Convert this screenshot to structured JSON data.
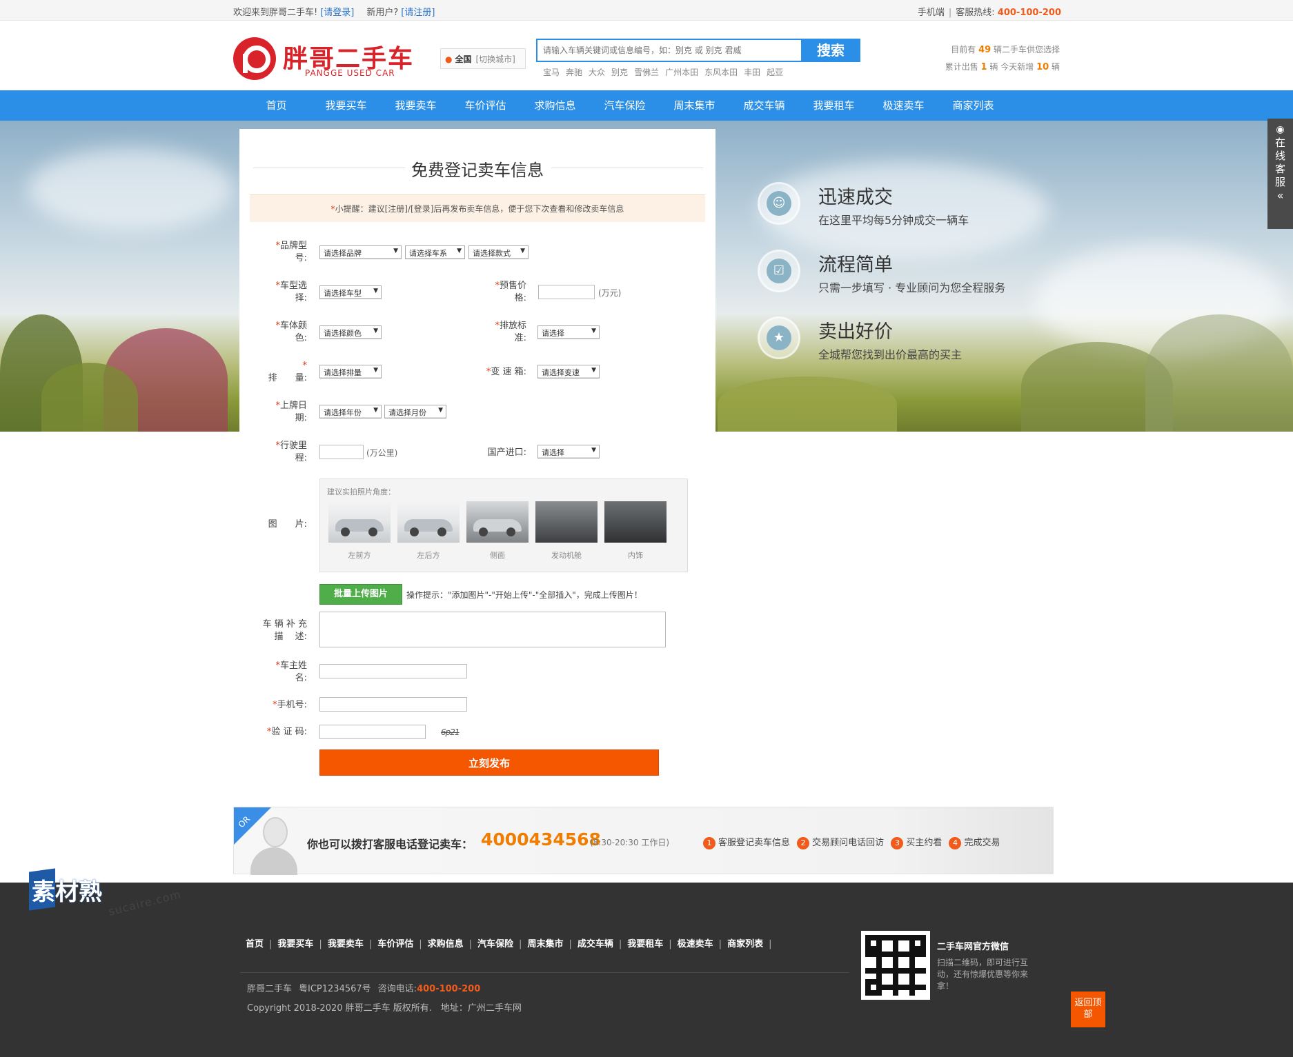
{
  "topbar": {
    "welcome": "欢迎来到胖哥二手车!",
    "login": "[请登录]",
    "new_user": "新用户?",
    "register": "[请注册]",
    "mobile": "手机端",
    "hotline_label": "客服热线:",
    "hotline": "400-100-200"
  },
  "logo": {
    "cn": "胖哥二手车",
    "en": "PANGGE USED CAR"
  },
  "city": {
    "current": "全国",
    "switch": "[切换城市]"
  },
  "search": {
    "placeholder": "请输入车辆关键词或信息编号，如：别克 或 别克 君威",
    "button": "搜索",
    "hotwords": [
      "宝马",
      "奔驰",
      "大众",
      "别克",
      "雪佛兰",
      "广州本田",
      "东风本田",
      "丰田",
      "起亚"
    ]
  },
  "stats": {
    "line1_pre": "目前有",
    "line1_num": "49",
    "line1_post": "辆二手车供您选择",
    "line2_pre": "累计出售",
    "line2_num1": "1",
    "line2_mid": "辆 今天新增",
    "line2_num2": "10",
    "line2_post": "辆"
  },
  "nav": [
    "首页",
    "我要买车",
    "我要卖车",
    "车价评估",
    "求购信息",
    "汽车保险",
    "周末集市",
    "成交车辆",
    "我要租车",
    "极速卖车",
    "商家列表"
  ],
  "form": {
    "title": "免费登记卖车信息",
    "tip_star": "*",
    "tip": "小提醒：建议[注册]/[登录]后再发布卖车信息，便于您下次查看和修改卖车信息",
    "req": "*",
    "labels": {
      "brand_a": "品牌型",
      "brand_b": "号:",
      "model_a": "车型选",
      "model_b": "择:",
      "price_a": "预售价",
      "price_b": "格:",
      "color_a": "车体颜",
      "color_b": "色:",
      "emission_a": "排放标",
      "emission_b": "准:",
      "displacement": "排　　量:",
      "gearbox": "变 速 箱:",
      "date_a": "上牌日",
      "date_b": "期:",
      "mileage_a": "行驶里",
      "mileage_b": "程:",
      "origin": "国产进口:",
      "photos": "图　　片:",
      "desc_a": "车 辆 补 充",
      "desc_b": "描　 述:",
      "owner_a": "车主姓",
      "owner_b": "名:",
      "phone": "手机号:",
      "captcha": "验 证 码:"
    },
    "selects": {
      "brand": "请选择品牌",
      "series": "请选择车系",
      "style": "请选择款式",
      "model": "请选择车型",
      "color": "请选择颜色",
      "emission": "请选择",
      "displacement": "请选择排量",
      "gearbox": "请选择变速",
      "year": "请选择年份",
      "month": "请选择月份",
      "origin": "请选择"
    },
    "units": {
      "price": "(万元)",
      "mileage": "(万公里)"
    },
    "photo_hint": "建议实拍照片角度：",
    "photo_angles": [
      "左前方",
      "左后方",
      "侧面",
      "发动机舱",
      "内饰"
    ],
    "upload_button": "批量上传图片",
    "upload_hint": "操作提示：\"添加图片\"-\"开始上传\"-\"全部插入\"，完成上传图片！",
    "captcha_code": "6p21",
    "submit": "立刻发布"
  },
  "features": [
    {
      "icon": "users-icon",
      "title": "迅速成交",
      "desc": "在这里平均每5分钟成交一辆车"
    },
    {
      "icon": "checklist-icon",
      "title": "流程简单",
      "desc": "只需一步填写 · 专业顾问为您全程服务"
    },
    {
      "icon": "trophy-icon",
      "title": "卖出好价",
      "desc": "全城帮您找到出价最高的买主"
    }
  ],
  "side": {
    "text": "在线客服",
    "chevron": "«"
  },
  "band": {
    "or": "OR",
    "call_text": "你也可以拨打客服电话登记卖车：",
    "phone": "4000434568",
    "hours": "(8:30-20:30 工作日)",
    "steps": [
      "客服登记卖车信息",
      "交易顾问电话回访",
      "买主约看",
      "完成交易"
    ]
  },
  "watermark": {
    "brand": "素材熟",
    "url": "sucaire.com"
  },
  "footer": {
    "nav": [
      "首页",
      "我要买车",
      "我要卖车",
      "车价评估",
      "求购信息",
      "汽车保险",
      "周末集市",
      "成交车辆",
      "我要租车",
      "极速卖车",
      "商家列表"
    ],
    "info_name": "胖哥二手车",
    "info_icp": "粤ICP1234567号",
    "info_phone_label": "咨询电话:",
    "info_phone": "400-100-200",
    "copyright": "Copyright 2018-2020 胖哥二手车 版权所有.　地址：广州二手车网",
    "wechat_title": "二手车网官方微信",
    "wechat_desc": "扫描二维码，即可进行互动，还有惊爆优惠等你来拿！",
    "to_top": "返回顶部"
  },
  "colors": {
    "brand_blue": "#2b8fe8",
    "accent_orange": "#f55600",
    "logo_red": "#d8232a",
    "upload_green": "#4fae4a"
  }
}
